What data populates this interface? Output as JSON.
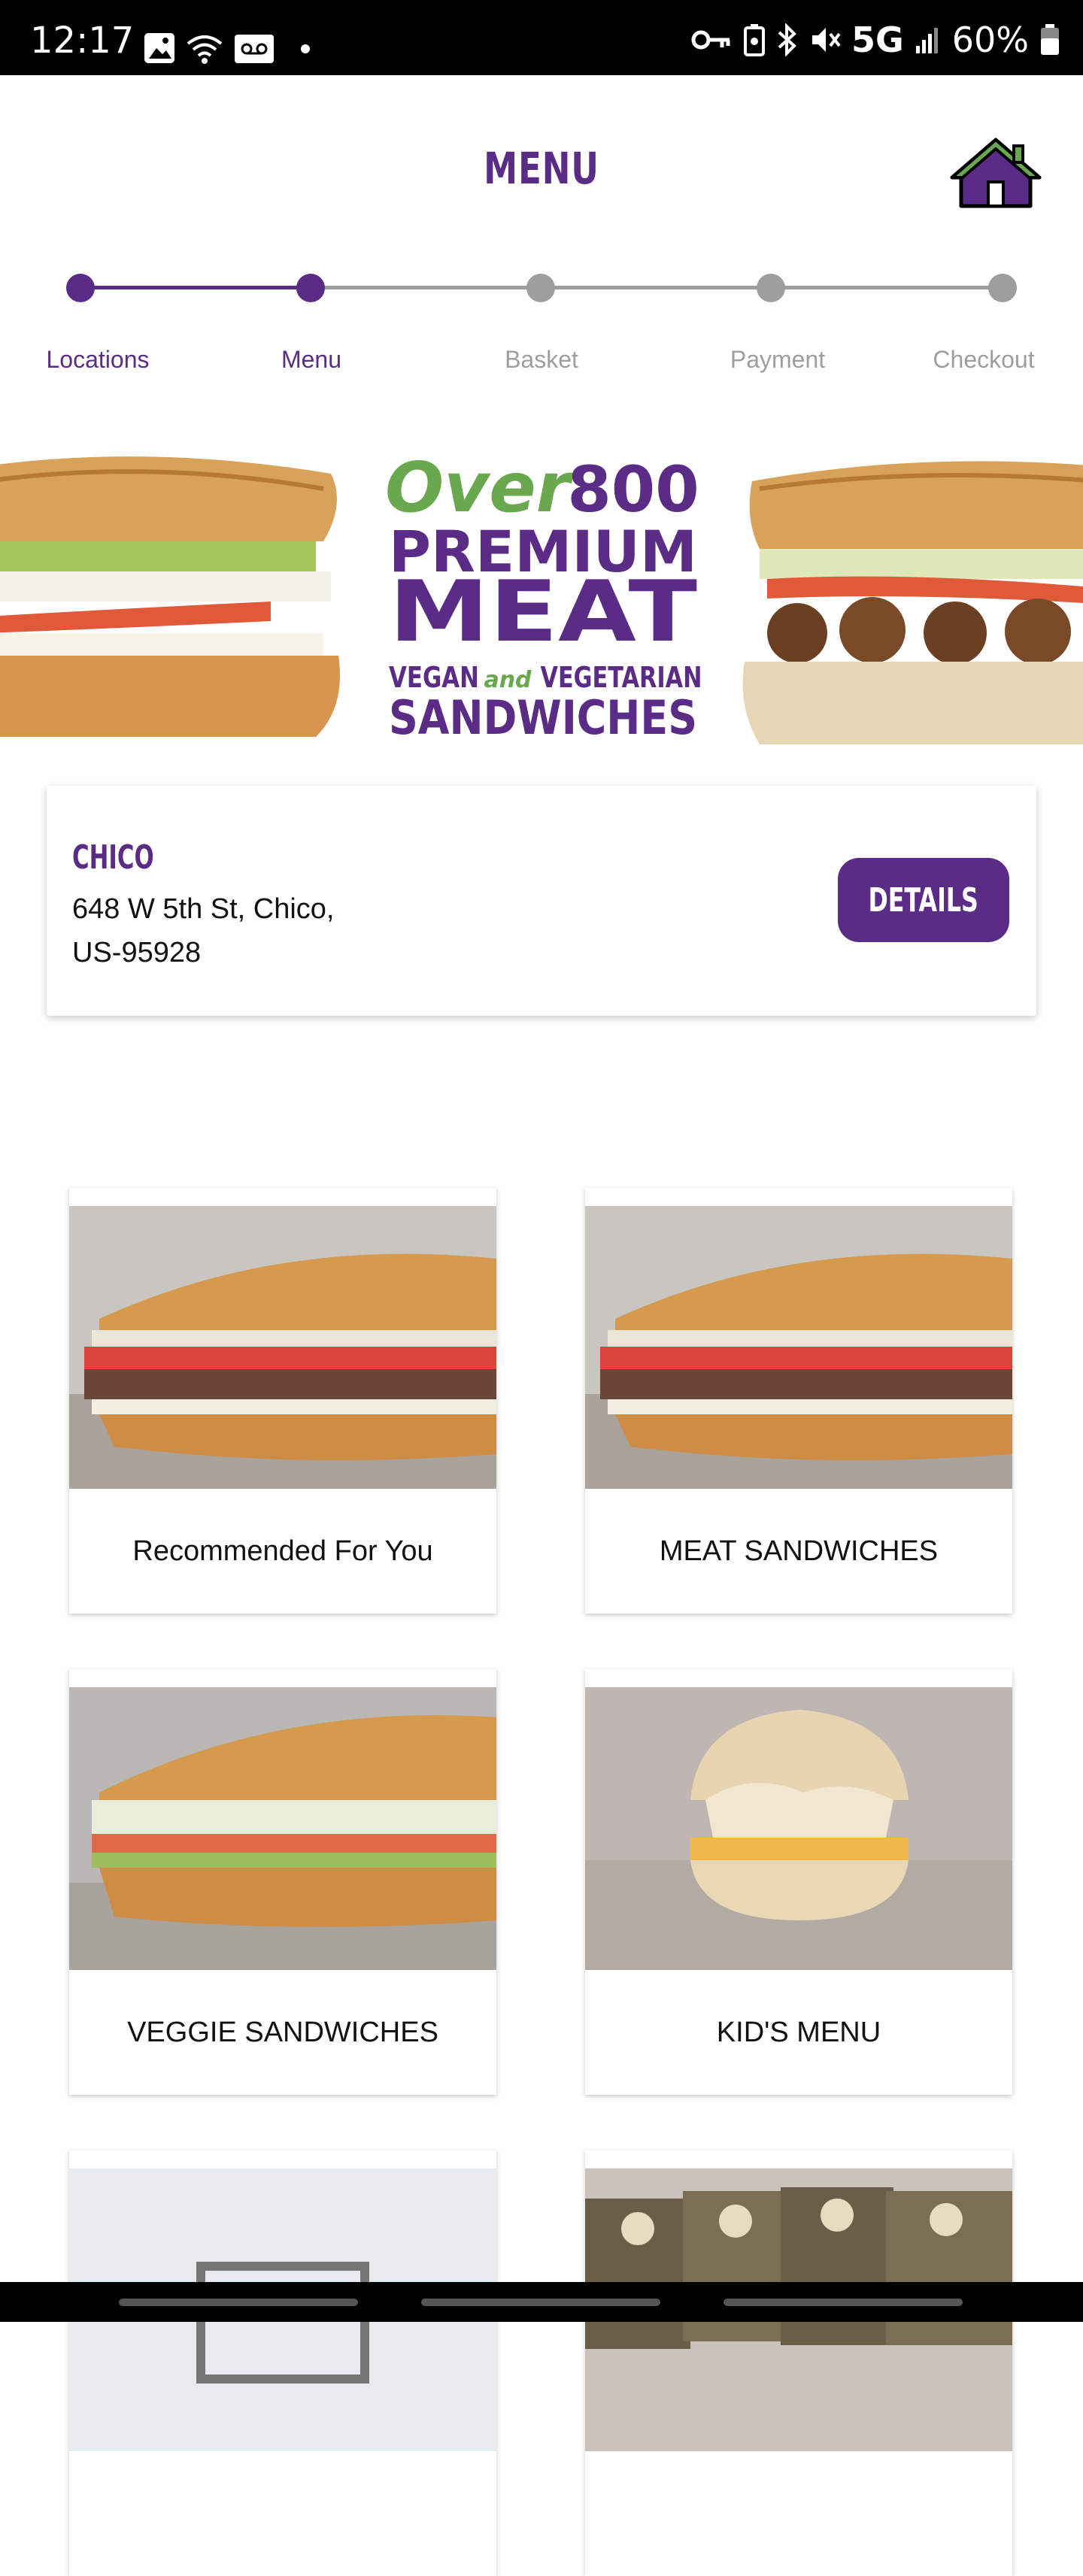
{
  "status": {
    "time": "12:17",
    "network": "5G",
    "battery": "60%"
  },
  "header": {
    "title": "MENU",
    "home_icon": "home-icon"
  },
  "stepper": {
    "steps": [
      {
        "label": "Locations",
        "state": "done"
      },
      {
        "label": "Menu",
        "state": "current"
      },
      {
        "label": "Basket",
        "state": "pending"
      },
      {
        "label": "Payment",
        "state": "pending"
      },
      {
        "label": "Checkout",
        "state": "pending"
      }
    ],
    "active_color": "#5b2c86",
    "inactive_color": "#9e9e9e"
  },
  "banner": {
    "line1_a": "Over",
    "line1_b": "800",
    "line2": "PREMIUM",
    "line3": "MEAT",
    "line4_a": "VEGAN",
    "line4_b": "and",
    "line4_c": "VEGETARIAN",
    "line5": "SANDWICHES",
    "green": "#6aa84f",
    "purple": "#5b2c86"
  },
  "location": {
    "name": "CHICO",
    "address_line1": "648 W 5th St, Chico,",
    "address_line2": "US-95928",
    "details_label": "DETAILS"
  },
  "categories": [
    {
      "label": "Recommended For You",
      "image": "meat-sandwich"
    },
    {
      "label": "MEAT SANDWICHES",
      "image": "meat-sandwich"
    },
    {
      "label": "VEGGIE SANDWICHES",
      "image": "veggie-sandwich"
    },
    {
      "label": "KID'S MENU",
      "image": "kids-sandwich"
    },
    {
      "label": "",
      "image": "placeholder-image"
    },
    {
      "label": "",
      "image": "cookies"
    }
  ],
  "colors": {
    "brand_purple": "#5b2c86"
  }
}
